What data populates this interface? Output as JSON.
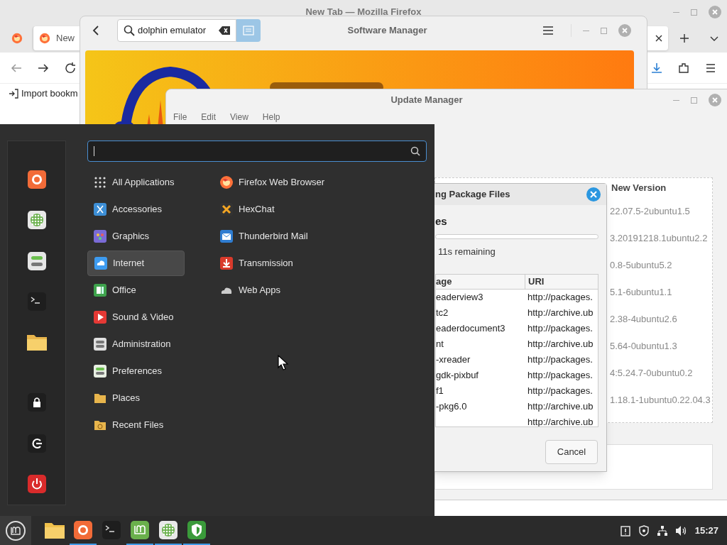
{
  "firefox": {
    "title": "New Tab — Mozilla Firefox",
    "tabs": [
      {
        "kind": "pinned",
        "selected": false
      },
      {
        "kind": "tab",
        "label": "New",
        "selected": true
      }
    ],
    "bookmarks": [
      "Import bookm"
    ]
  },
  "software_manager": {
    "title": "Software Manager",
    "search": {
      "value": "dolphin emulator"
    }
  },
  "update_manager": {
    "title": "Update Manager",
    "menus": [
      "File",
      "Edit",
      "View",
      "Help"
    ],
    "column": "New Version",
    "versions": [
      "22.07.5-2ubuntu1.5",
      "3.20191218.1ubuntu2.2",
      "0.8-5ubuntu5.2",
      "5.1-6ubuntu1.1",
      "2.38-4ubuntu2.6",
      "5.64-0ubuntu1.3",
      "4:5.24.7-0ubuntu0.2",
      "1.18.1-1ubuntu0.22.04.3"
    ]
  },
  "dialog": {
    "title": "ng Package Files",
    "heading": "es",
    "remaining": "11s remaining",
    "columns": [
      "age",
      "URI"
    ],
    "rows": [
      {
        "package": "eaderview3",
        "uri": "http://packages."
      },
      {
        "package": "tc2",
        "uri": "http://archive.ub"
      },
      {
        "package": "eaderdocument3",
        "uri": "http://packages."
      },
      {
        "package": "nt",
        "uri": "http://archive.ub"
      },
      {
        "package": "-xreader",
        "uri": "http://packages."
      },
      {
        "package": "gdk-pixbuf",
        "uri": "http://packages."
      },
      {
        "package": "f1",
        "uri": "http://packages."
      },
      {
        "package": "-pkg6.0",
        "uri": "http://archive.ub"
      },
      {
        "uri": "http://archive.ub"
      }
    ],
    "button": "Cancel"
  },
  "menu": {
    "categories": [
      {
        "label": "All Applications",
        "selected": false
      },
      {
        "label": "Accessories",
        "selected": false
      },
      {
        "label": "Graphics",
        "selected": false
      },
      {
        "label": "Internet",
        "selected": true
      },
      {
        "label": "Office",
        "selected": false
      },
      {
        "label": "Sound & Video",
        "selected": false
      },
      {
        "label": "Administration",
        "selected": false
      },
      {
        "label": "Preferences",
        "selected": false
      },
      {
        "label": "Places",
        "selected": false
      },
      {
        "label": "Recent Files",
        "selected": false
      }
    ],
    "apps": [
      "Firefox Web Browser",
      "HexChat",
      "Thunderbird Mail",
      "Transmission",
      "Web Apps"
    ]
  },
  "taskbar": {
    "launchers": [
      {
        "kind": "folder",
        "running": false
      },
      {
        "kind": "browser",
        "running": true
      },
      {
        "kind": "terminal",
        "running": false
      },
      {
        "kind": "mint",
        "running": true
      },
      {
        "kind": "webapps",
        "running": true
      },
      {
        "kind": "shield",
        "running": true
      }
    ],
    "clock": "15:27"
  }
}
